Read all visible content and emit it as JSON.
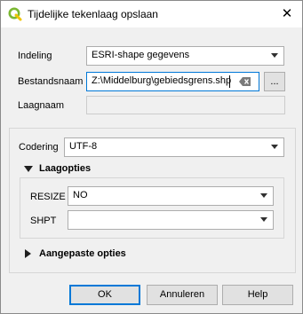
{
  "window": {
    "title": "Tijdelijke tekenlaag opslaan",
    "close_icon": "close-icon",
    "logo_icon": "qgis-logo-icon"
  },
  "form": {
    "format": {
      "label": "Indeling",
      "value": "ESRI-shape gegevens"
    },
    "filename": {
      "label": "Bestandsnaam",
      "value": "Z:\\Middelburg\\gebiedsgrens.shp",
      "browse_label": "..."
    },
    "layername": {
      "label": "Laagnaam",
      "value": ""
    }
  },
  "encoding": {
    "label": "Codering",
    "value": "UTF-8"
  },
  "layer_options": {
    "title": "Laagopties",
    "rows": [
      {
        "label": "RESIZE",
        "value": "NO"
      },
      {
        "label": "SHPT",
        "value": ""
      }
    ]
  },
  "custom_options": {
    "title": "Aangepaste opties"
  },
  "buttons": {
    "ok": "OK",
    "cancel": "Annuleren",
    "help": "Help"
  },
  "colors": {
    "accent": "#0078d7",
    "qgis_green": "#7bb833",
    "qgis_yellow": "#f0c400"
  }
}
